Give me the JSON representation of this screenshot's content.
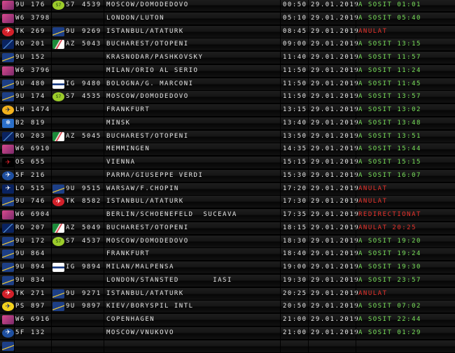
{
  "colors": {
    "board_bg": "#000000",
    "text": "#e6e6e6",
    "status_ok": "#78e05a",
    "status_cancelled": "#e8322c"
  },
  "flights": [
    {
      "logo1": "wizz-icon",
      "code1": "9U",
      "num1": "176",
      "logo2": "s7-icon",
      "code2": "S7",
      "num2": "4539",
      "dest": "MOSCOW/DOMODEDOVO",
      "time": "00:50",
      "date": "29.01.2019",
      "status": "A SOSIT 01:01",
      "kind": "ok"
    },
    {
      "logo1": "wizz-icon",
      "code1": "W6",
      "num1": "3798",
      "logo2": "",
      "code2": "",
      "num2": "",
      "dest": "LONDON/LUTON",
      "time": "05:10",
      "date": "29.01.2019",
      "status": "A SOSIT 05:40",
      "kind": "ok"
    },
    {
      "logo1": "turkish-icon",
      "code1": "TK",
      "num1": "269",
      "logo2": "airmoldova-icon",
      "code2": "9U",
      "num2": "9269",
      "dest": "ISTANBUL/ATATURK",
      "time": "08:45",
      "date": "29.01.2019",
      "status": "ANULAT",
      "kind": "bad"
    },
    {
      "logo1": "tarom-icon",
      "code1": "RO",
      "num1": "201",
      "logo2": "alitalia-icon",
      "code2": "AZ",
      "num2": "5043",
      "dest": "BUCHAREST/OTOPENI",
      "time": "09:00",
      "date": "29.01.2019",
      "status": "A SOSIT 13:15",
      "kind": "ok"
    },
    {
      "logo1": "airmoldova-icon",
      "code1": "9U",
      "num1": "152",
      "logo2": "",
      "code2": "",
      "num2": "",
      "dest": "KRASNODAR/PASHKOVSKY",
      "time": "11:40",
      "date": "29.01.2019",
      "status": "A SOSIT 11:57",
      "kind": "ok"
    },
    {
      "logo1": "wizz-icon",
      "code1": "W6",
      "num1": "3796",
      "logo2": "",
      "code2": "",
      "num2": "",
      "dest": "MILAN/ORIO AL SERIO",
      "time": "11:50",
      "date": "29.01.2019",
      "status": "A SOSIT 11:24",
      "kind": "ok"
    },
    {
      "logo1": "airmoldova-icon",
      "code1": "9U",
      "num1": "480",
      "logo2": "airmoldova-small-icon",
      "code2": "IG",
      "num2": "9480",
      "dest": "BOLOGNA/G. MARCONI",
      "time": "11:50",
      "date": "29.01.2019",
      "status": "A SOSIT 11:45",
      "kind": "ok"
    },
    {
      "logo1": "airmoldova-icon",
      "code1": "9U",
      "num1": "174",
      "logo2": "s7-icon",
      "code2": "S7",
      "num2": "4535",
      "dest": "MOSCOW/DOMODEDOVO",
      "time": "11:50",
      "date": "29.01.2019",
      "status": "A SOSIT 13:57",
      "kind": "ok"
    },
    {
      "logo1": "lufthansa-icon",
      "code1": "LH",
      "num1": "1474",
      "logo2": "",
      "code2": "",
      "num2": "",
      "dest": "FRANKFURT",
      "time": "13:15",
      "date": "29.01.2019",
      "status": "A SOSIT 13:02",
      "kind": "ok"
    },
    {
      "logo1": "belavia-icon",
      "code1": "B2",
      "num1": "819",
      "logo2": "",
      "code2": "",
      "num2": "",
      "dest": "MINSK",
      "time": "13:40",
      "date": "29.01.2019",
      "status": "A SOSIT 13:48",
      "kind": "ok"
    },
    {
      "logo1": "tarom-icon",
      "code1": "RO",
      "num1": "203",
      "logo2": "alitalia-icon",
      "code2": "AZ",
      "num2": "5045",
      "dest": "BUCHAREST/OTOPENI",
      "time": "13:50",
      "date": "29.01.2019",
      "status": "A SOSIT 13:51",
      "kind": "ok"
    },
    {
      "logo1": "wizz-icon",
      "code1": "W6",
      "num1": "6910",
      "logo2": "",
      "code2": "",
      "num2": "",
      "dest": "MEMMINGEN",
      "time": "14:35",
      "date": "29.01.2019",
      "status": "A SOSIT 15:44",
      "kind": "ok"
    },
    {
      "logo1": "austrian-icon",
      "code1": "OS",
      "num1": "655",
      "logo2": "",
      "code2": "",
      "num2": "",
      "dest": "VIENNA",
      "time": "15:15",
      "date": "29.01.2019",
      "status": "A SOSIT 15:15",
      "kind": "ok"
    },
    {
      "logo1": "flyone-icon",
      "code1": "5F",
      "num1": "216",
      "logo2": "",
      "code2": "",
      "num2": "",
      "dest": "PARMA/GIUSEPPE VERDI",
      "time": "15:30",
      "date": "29.01.2019",
      "status": "A SOSIT 16:07",
      "kind": "ok"
    },
    {
      "logo1": "lot-icon",
      "code1": "LO",
      "num1": "515",
      "logo2": "airmoldova-icon",
      "code2": "9U",
      "num2": "9515",
      "dest": "WARSAW/F.CHOPIN",
      "time": "17:20",
      "date": "29.01.2019",
      "status": "ANULAT",
      "kind": "bad"
    },
    {
      "logo1": "airmoldova-icon",
      "code1": "9U",
      "num1": "746",
      "logo2": "turkish-icon",
      "code2": "TK",
      "num2": "8582",
      "dest": "ISTANBUL/ATATURK",
      "time": "17:30",
      "date": "29.01.2019",
      "status": "ANULAT",
      "kind": "bad"
    },
    {
      "logo1": "wizz-icon",
      "code1": "W6",
      "num1": "6904",
      "logo2": "",
      "code2": "",
      "num2": "",
      "dest": "BERLIN/SCHOENEFELD  SUCEAVA",
      "time": "17:35",
      "date": "29.01.2019",
      "status": "REDIRECTIONAT",
      "kind": "bad"
    },
    {
      "logo1": "tarom-icon",
      "code1": "RO",
      "num1": "207",
      "logo2": "alitalia-icon",
      "code2": "AZ",
      "num2": "5049",
      "dest": "BUCHAREST/OTOPENI",
      "time": "18:15",
      "date": "29.01.2019",
      "status": "ANULAT 20:25",
      "kind": "bad"
    },
    {
      "logo1": "airmoldova-icon",
      "code1": "9U",
      "num1": "172",
      "logo2": "s7-icon",
      "code2": "S7",
      "num2": "4537",
      "dest": "MOSCOW/DOMODEDOVO",
      "time": "18:30",
      "date": "29.01.2019",
      "status": "A SOSIT 19:20",
      "kind": "ok"
    },
    {
      "logo1": "airmoldova-icon",
      "code1": "9U",
      "num1": "864",
      "logo2": "",
      "code2": "",
      "num2": "",
      "dest": "FRANKFURT",
      "time": "18:40",
      "date": "29.01.2019",
      "status": "A SOSIT 19:24",
      "kind": "ok"
    },
    {
      "logo1": "airmoldova-icon",
      "code1": "9U",
      "num1": "894",
      "logo2": "airmoldova-small-icon",
      "code2": "IG",
      "num2": "9894",
      "dest": "MILAN/MALPENSA",
      "time": "19:00",
      "date": "29.01.2019",
      "status": "A SOSIT 19:30",
      "kind": "ok"
    },
    {
      "logo1": "airmoldova-icon",
      "code1": "9U",
      "num1": "834",
      "logo2": "",
      "code2": "",
      "num2": "",
      "dest": "LONDON/STANSTED       IASI",
      "time": "19:30",
      "date": "29.01.2019",
      "status": "A SOSIT 23:57",
      "kind": "ok"
    },
    {
      "logo1": "turkish-icon",
      "code1": "TK",
      "num1": "271",
      "logo2": "airmoldova-icon",
      "code2": "9U",
      "num2": "9271",
      "dest": "ISTANBUL/ATATURK",
      "time": "20:25",
      "date": "29.01.2019",
      "status": "ANULAT",
      "kind": "bad"
    },
    {
      "logo1": "ps-icon",
      "code1": "PS",
      "num1": "897",
      "logo2": "airmoldova-icon",
      "code2": "9U",
      "num2": "9897",
      "dest": "KIEV/BORYSPIL INTL",
      "time": "20:50",
      "date": "29.01.2019",
      "status": "A SOSIT 07:02",
      "kind": "ok"
    },
    {
      "logo1": "wizz-icon",
      "code1": "W6",
      "num1": "6916",
      "logo2": "",
      "code2": "",
      "num2": "",
      "dest": "COPENHAGEN",
      "time": "21:00",
      "date": "29.01.2019",
      "status": "A SOSIT 22:44",
      "kind": "ok"
    },
    {
      "logo1": "flyone-icon",
      "code1": "5F",
      "num1": "132",
      "logo2": "",
      "code2": "",
      "num2": "",
      "dest": "MOSCOW/VNUKOVO",
      "time": "21:00",
      "date": "29.01.2019",
      "status": "A SOSIT 01:29",
      "kind": "ok"
    },
    {
      "logo1": "airmoldova-icon",
      "code1": "",
      "num1": "",
      "logo2": "",
      "code2": "",
      "num2": "",
      "dest": "",
      "time": "",
      "date": "",
      "status": "",
      "kind": "ok"
    }
  ]
}
